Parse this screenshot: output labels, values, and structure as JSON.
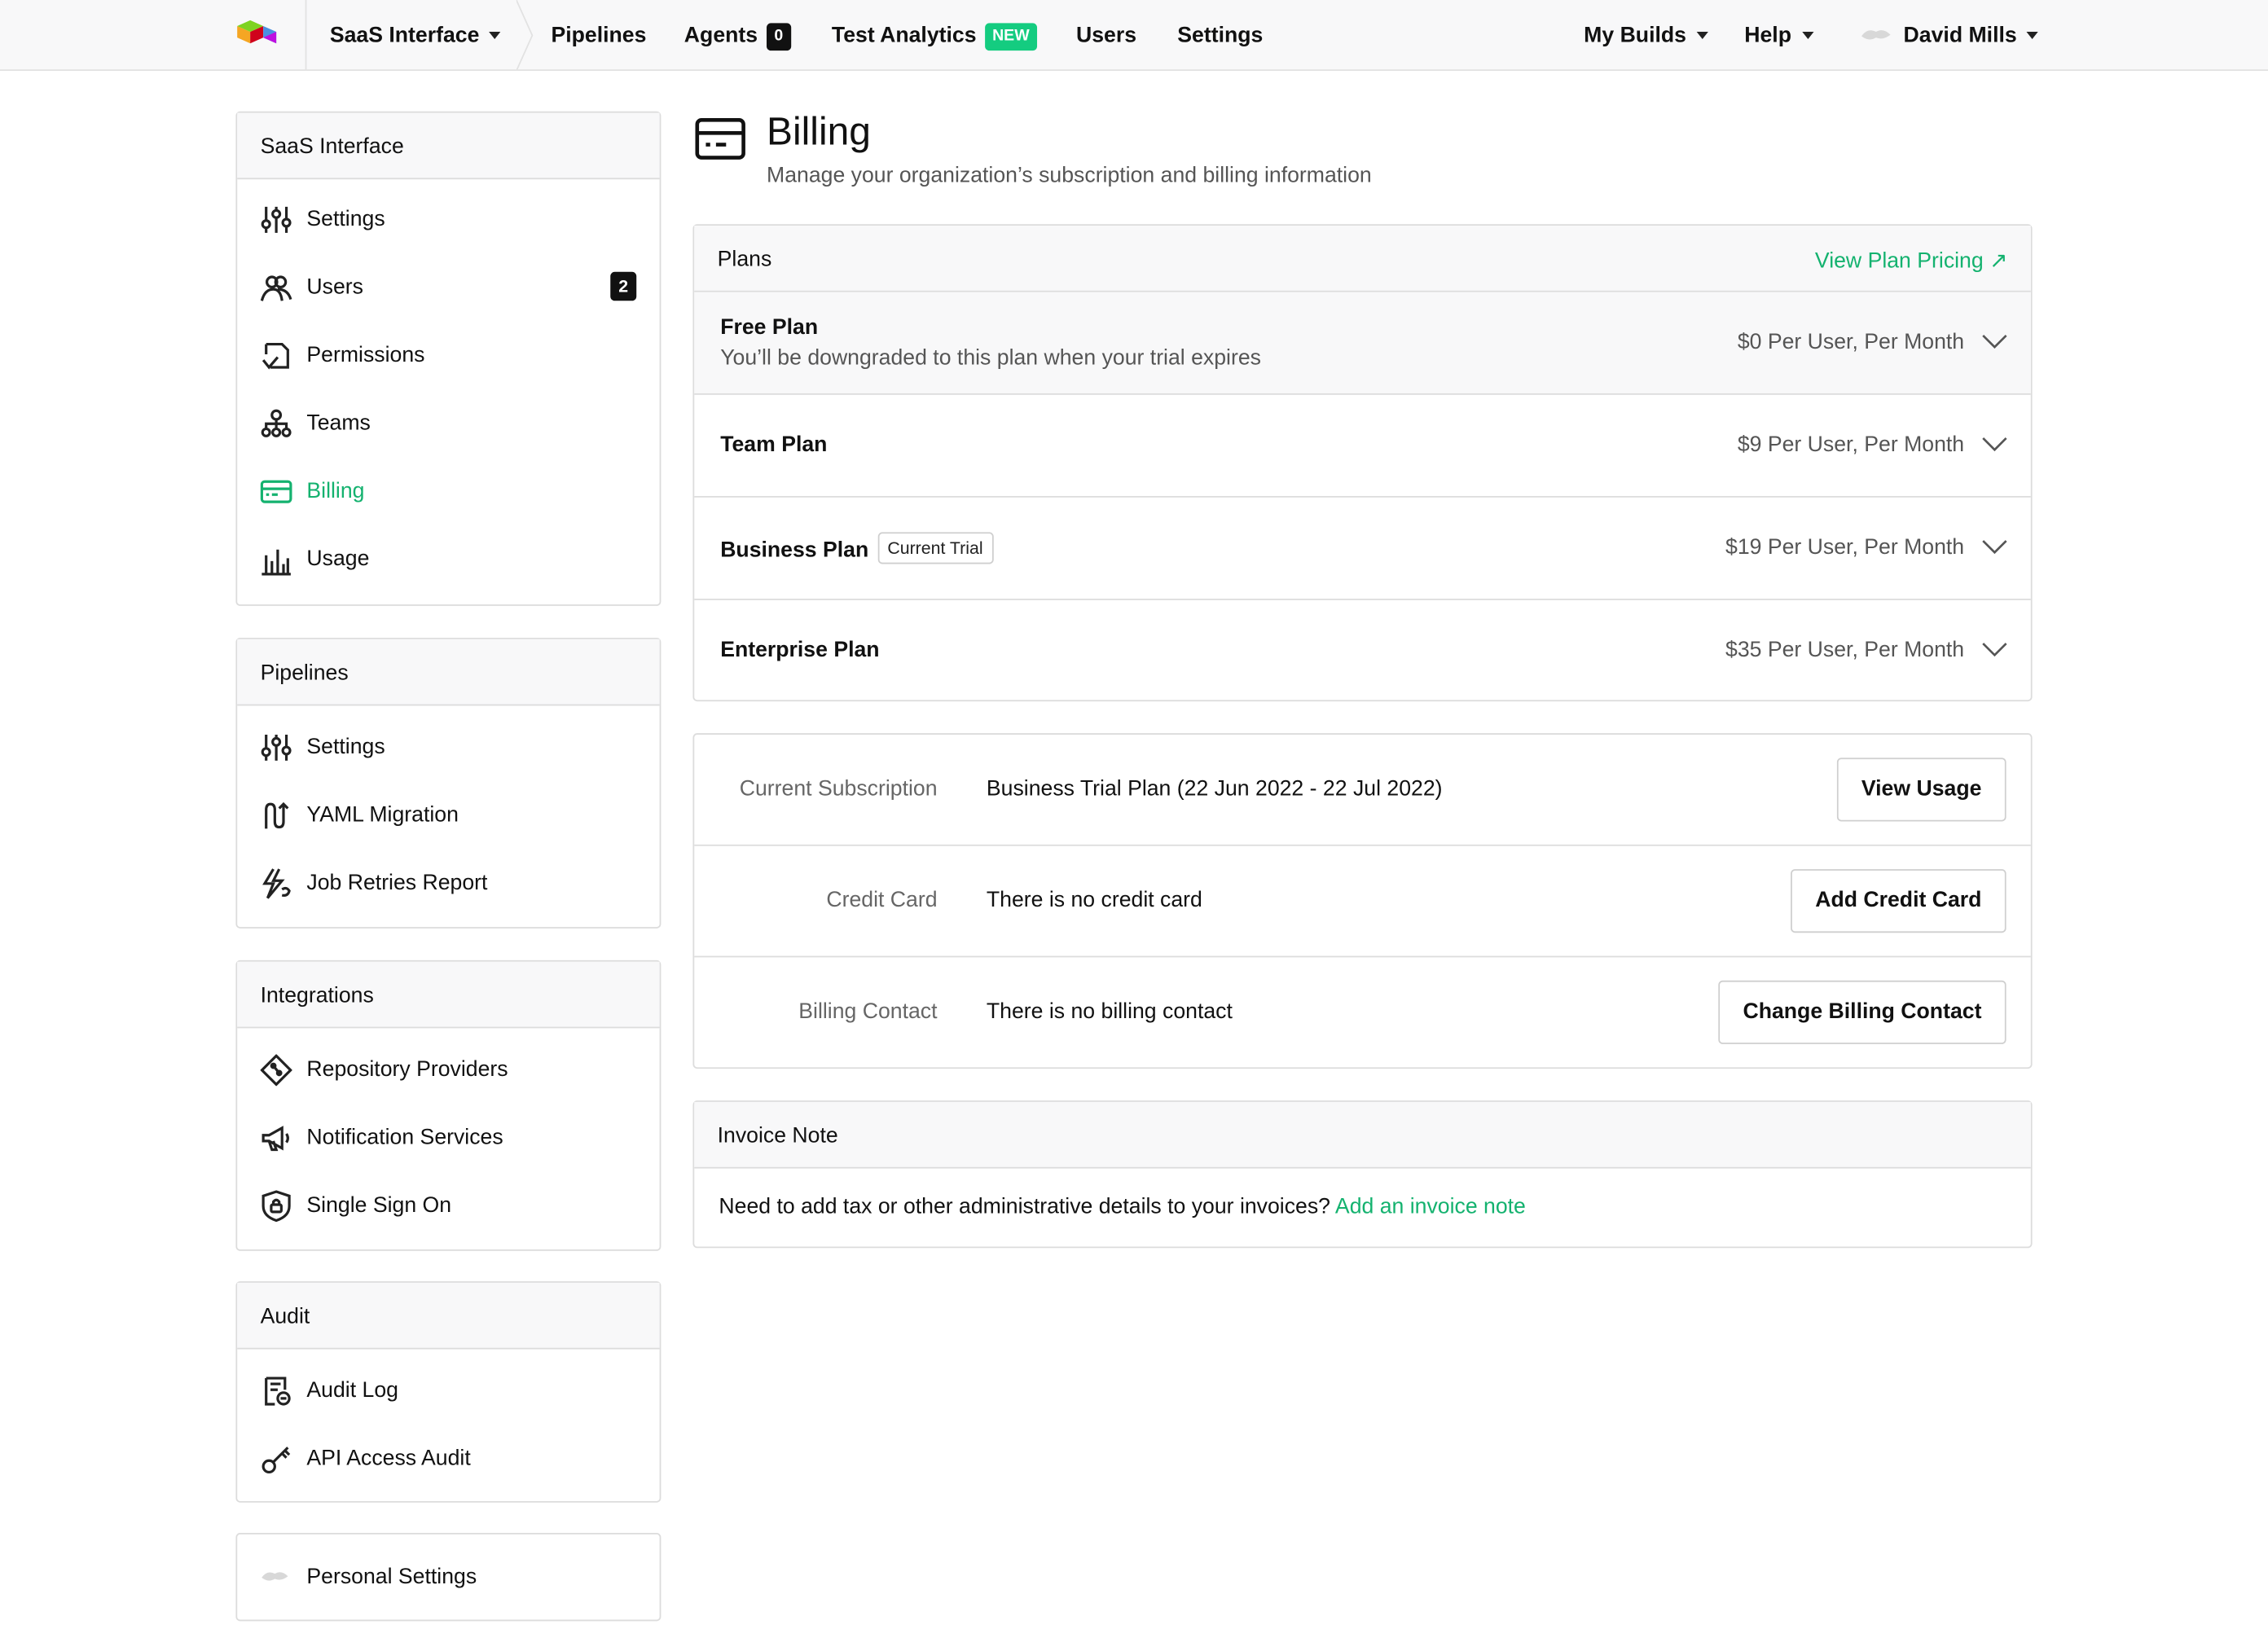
{
  "topnav": {
    "org": "SaaS Interface",
    "links": {
      "pipelines": "Pipelines",
      "agents": "Agents",
      "agents_count": "0",
      "test_analytics": "Test Analytics",
      "new_badge": "NEW",
      "users": "Users",
      "settings": "Settings"
    },
    "my_builds": "My Builds",
    "help": "Help",
    "user_name": "David Mills"
  },
  "sidebar": {
    "org": {
      "title": "SaaS Interface",
      "items": [
        {
          "label": "Settings",
          "icon": "sliders-icon"
        },
        {
          "label": "Users",
          "icon": "users-icon",
          "count": "2"
        },
        {
          "label": "Permissions",
          "icon": "permissions-icon"
        },
        {
          "label": "Teams",
          "icon": "teams-icon"
        },
        {
          "label": "Billing",
          "icon": "billing-icon",
          "active": true
        },
        {
          "label": "Usage",
          "icon": "usage-chart-icon"
        }
      ]
    },
    "pipelines": {
      "title": "Pipelines",
      "items": [
        {
          "label": "Settings",
          "icon": "sliders-icon"
        },
        {
          "label": "YAML Migration",
          "icon": "migration-icon"
        },
        {
          "label": "Job Retries Report",
          "icon": "retry-icon"
        }
      ]
    },
    "integrations": {
      "title": "Integrations",
      "items": [
        {
          "label": "Repository Providers",
          "icon": "git-icon"
        },
        {
          "label": "Notification Services",
          "icon": "megaphone-icon"
        },
        {
          "label": "Single Sign On",
          "icon": "shield-lock-icon"
        }
      ]
    },
    "audit": {
      "title": "Audit",
      "items": [
        {
          "label": "Audit Log",
          "icon": "audit-log-icon"
        },
        {
          "label": "API Access Audit",
          "icon": "key-icon"
        }
      ]
    },
    "personal": {
      "label": "Personal Settings",
      "icon": "avatar-icon"
    }
  },
  "page": {
    "title": "Billing",
    "subtitle": "Manage your organization’s subscription and billing information"
  },
  "plans": {
    "title": "Plans",
    "pricing_link": "View Plan Pricing ↗",
    "rows": [
      {
        "name": "Free Plan",
        "desc": "You’ll be downgraded to this plan when your trial expires",
        "price": "$0 Per User, Per Month"
      },
      {
        "name": "Team Plan",
        "price": "$9 Per User, Per Month"
      },
      {
        "name": "Business Plan",
        "tag": "Current Trial",
        "price": "$19 Per User, Per Month"
      },
      {
        "name": "Enterprise Plan",
        "price": "$35 Per User, Per Month"
      }
    ]
  },
  "subscription": {
    "rows": [
      {
        "label": "Current Subscription",
        "value": "Business Trial Plan (22 Jun 2022 - 22 Jul 2022)",
        "button": "View Usage"
      },
      {
        "label": "Credit Card",
        "value": "There is no credit card",
        "button": "Add Credit Card"
      },
      {
        "label": "Billing Contact",
        "value": "There is no billing contact",
        "button": "Change Billing Contact"
      }
    ]
  },
  "invoice": {
    "title": "Invoice Note",
    "text": "Need to add tax or other administrative details to your invoices?",
    "link": "Add an invoice note"
  }
}
